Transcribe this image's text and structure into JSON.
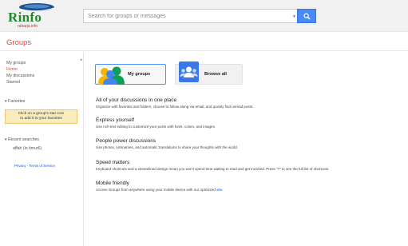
{
  "app": {
    "logo": {
      "word": "Rinfo",
      "subtitle": "raharja.info"
    },
    "search": {
      "placeholder": "Search for groups or messages",
      "caret_icon": "dropdown-caret",
      "button_icon": "search-icon"
    },
    "section_title": "Groups"
  },
  "sidebar": {
    "nav": [
      "My groups",
      "Home",
      "My discussions",
      "Starred"
    ],
    "active_item": "Home",
    "favorites": {
      "heading": "Favorites",
      "note_line1": "Click on a group's star icon",
      "note_line2": "to add it to your favorites"
    },
    "recent": {
      "heading": "Recent searches",
      "items": [
        "affah (in timur6)"
      ]
    },
    "footer": {
      "privacy": "Privacy",
      "separator": " - ",
      "terms": "Terms of Service"
    }
  },
  "main": {
    "buttons": {
      "my_groups": "My groups",
      "browse_all": "Browse all"
    },
    "features": [
      {
        "title": "All of your discussions in one place",
        "desc": "Organize with favorites and folders, choose to follow along via email, and quickly find unread posts."
      },
      {
        "title": "Express yourself",
        "desc": "Use rich-text editing to customize your posts with fonts, colors, and images."
      },
      {
        "title": "People power discussions",
        "desc": "Use photos, nicknames, and automatic translations to share your thoughts with the world."
      },
      {
        "title": "Speed matters",
        "desc": "Keyboard shortcuts and a streamlined design mean you won't spend time waiting to read and get involved. Press \"?\" to see the full list of shortcuts."
      },
      {
        "title": "Mobile friendly",
        "desc_prefix": "Access Groups from anywhere using your mobile device with our optimized ",
        "desc_link": "site",
        "desc_suffix": "."
      }
    ]
  },
  "colors": {
    "accent_red": "#dd4b39",
    "blue": "#4a8af4",
    "link": "#1155cc",
    "note_bg": "#f9edbe"
  }
}
